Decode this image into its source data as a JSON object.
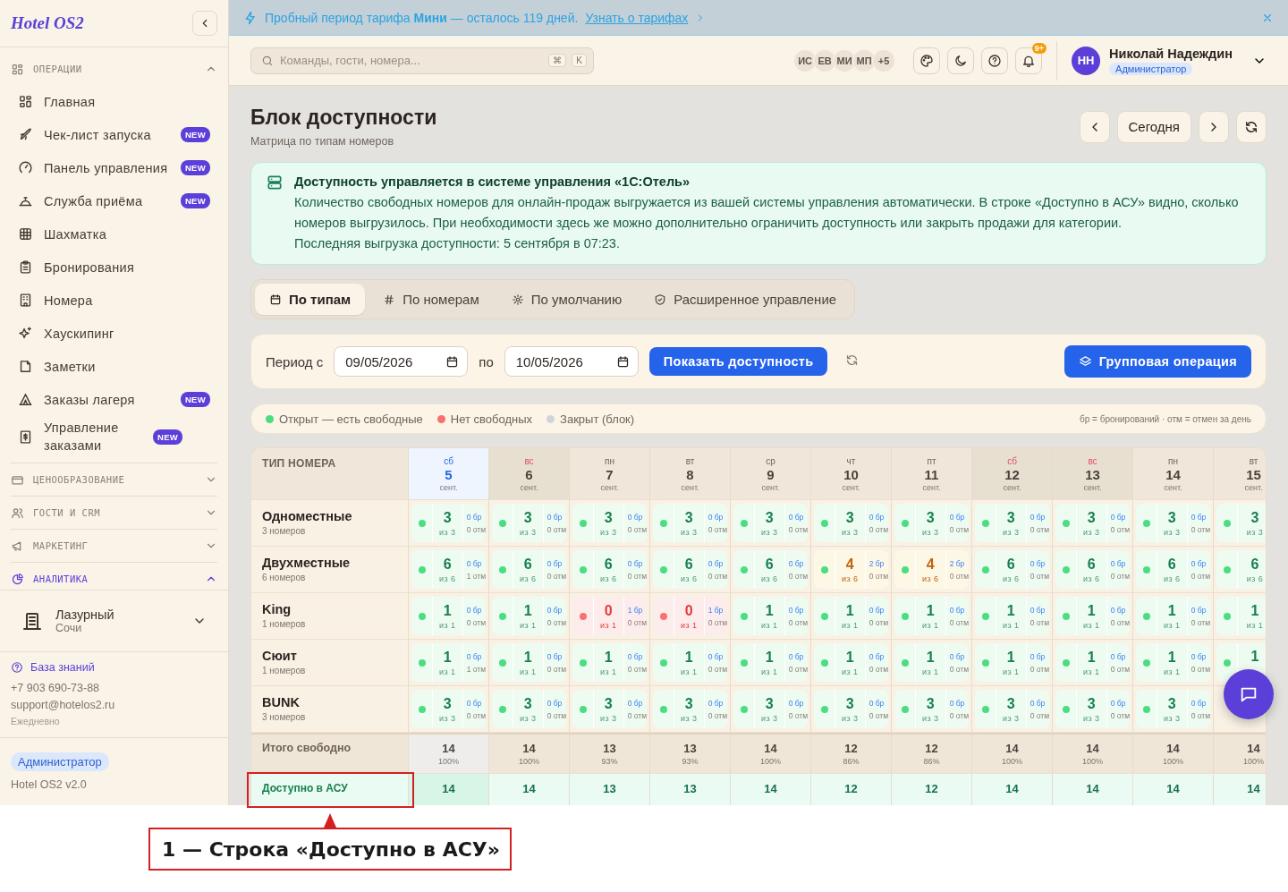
{
  "trial_banner": {
    "text": "Пробный период тарифа **Мини** — осталось 119 дней.",
    "link": "Узнать о тарифах"
  },
  "sidebar": {
    "logo": "Hotel OS2",
    "sections": [
      {
        "title": "ОПЕРАЦИИ",
        "expanded": true,
        "active": false,
        "items": [
          {
            "label": "Главная"
          },
          {
            "label": "Чек-лист запуска",
            "badge": "NEW"
          },
          {
            "label": "Панель управления",
            "badge": "NEW"
          },
          {
            "label": "Служба приёма",
            "badge": "NEW"
          },
          {
            "label": "Шахматка"
          },
          {
            "label": "Бронирования"
          },
          {
            "label": "Номера"
          },
          {
            "label": "Хаускипинг"
          },
          {
            "label": "Заметки"
          },
          {
            "label": "Заказы лагеря",
            "badge": "NEW"
          },
          {
            "label": "Управление заказами",
            "badge": "NEW"
          }
        ]
      },
      {
        "title": "ЦЕНООБРАЗОВАНИЕ",
        "expanded": false,
        "active": false
      },
      {
        "title": "ГОСТИ И CRM",
        "expanded": false,
        "active": false
      },
      {
        "title": "МАРКЕТИНГ",
        "expanded": false,
        "active": false
      },
      {
        "title": "АНАЛИТИКА",
        "expanded": true,
        "active": true
      }
    ],
    "property": {
      "name": "Лазурный",
      "city": "Сочи"
    },
    "help_link": "База знаний",
    "phone": "+7 903 690-73-88",
    "email": "support@hotelos2.ru",
    "hours": "Ежедневно",
    "role": "Администратор",
    "version": "Hotel OS2 v2.0"
  },
  "topbar": {
    "search": {
      "placeholder": "Команды, гости, номера..."
    },
    "shortcut": [
      "⌘",
      "K"
    ],
    "avatars": [
      "ИС",
      "ЕВ",
      "МИ",
      "МП"
    ],
    "avatars_more": "+5",
    "notifications": "9+",
    "user": {
      "initials": "НН",
      "name": "Николай Надеждин",
      "role": "Администратор"
    }
  },
  "page": {
    "title": "Блок доступности",
    "subtitle": "Матрица по типам номеров",
    "today": "Сегодня"
  },
  "info": {
    "title": "Доступность управляется в системе управления «1С:Отель»",
    "text": "Количество свободных номеров для онлайн-продаж выгружается из вашей системы управления автоматически. В строке «Доступно в АСУ» видно, сколько номеров выгрузилось. При необходимости здесь же можно дополнительно ограничить доступность или закрыть продажи для категории.",
    "last_sync": "Последняя выгрузка доступности: 5 сентября в 07:23."
  },
  "tabs": [
    {
      "label": "По типам",
      "selected": true
    },
    {
      "label": "По номерам",
      "selected": false
    },
    {
      "label": "По умолчанию",
      "selected": false
    },
    {
      "label": "Расширенное управление",
      "selected": false
    }
  ],
  "filter": {
    "from_label": "Период с",
    "from": "09/05/2026",
    "to_label": "по",
    "to": "10/05/2026",
    "show_button": "Показать доступность",
    "group_button": "Групповая операция"
  },
  "legend": {
    "items": [
      {
        "label": "Открыт — есть свободные",
        "color": "#4ade80"
      },
      {
        "label": "Нет свободных",
        "color": "#f87171"
      },
      {
        "label": "Закрыт (блок)",
        "color": "#d1d5db"
      }
    ],
    "note": "бр = бронирований · отм = отмен за день"
  },
  "table": {
    "corner": "ТИП НОМЕРА",
    "days": [
      {
        "weekday": "сб",
        "day": "5",
        "month": "сент.",
        "weekend": true,
        "selected": true
      },
      {
        "weekday": "вс",
        "day": "6",
        "month": "сент.",
        "weekend": true,
        "selected": false
      },
      {
        "weekday": "пн",
        "day": "7",
        "month": "сент.",
        "weekend": false,
        "selected": false
      },
      {
        "weekday": "вт",
        "day": "8",
        "month": "сент.",
        "weekend": false,
        "selected": false
      },
      {
        "weekday": "ср",
        "day": "9",
        "month": "сент.",
        "weekend": false,
        "selected": false
      },
      {
        "weekday": "чт",
        "day": "10",
        "month": "сент.",
        "weekend": false,
        "selected": false
      },
      {
        "weekday": "пт",
        "day": "11",
        "month": "сент.",
        "weekend": false,
        "selected": false
      },
      {
        "weekday": "сб",
        "day": "12",
        "month": "сент.",
        "weekend": true,
        "selected": false
      },
      {
        "weekday": "вс",
        "day": "13",
        "month": "сент.",
        "weekend": true,
        "selected": false
      },
      {
        "weekday": "пн",
        "day": "14",
        "month": "сент.",
        "weekend": false,
        "selected": false
      },
      {
        "weekday": "вт",
        "day": "15",
        "month": "сент.",
        "weekend": false,
        "selected": false
      }
    ],
    "rows": [
      {
        "name": "Одноместные",
        "count": "3 номеров",
        "cells": [
          {
            "kind": "open",
            "free": "3",
            "total": "из 3",
            "booked": "0 бр",
            "cancelled": "0 отм"
          },
          {
            "kind": "open",
            "free": "3",
            "total": "из 3",
            "booked": "0 бр",
            "cancelled": "0 отм"
          },
          {
            "kind": "open",
            "free": "3",
            "total": "из 3",
            "booked": "0 бр",
            "cancelled": "0 отм"
          },
          {
            "kind": "open",
            "free": "3",
            "total": "из 3",
            "booked": "0 бр",
            "cancelled": "0 отм"
          },
          {
            "kind": "open",
            "free": "3",
            "total": "из 3",
            "booked": "0 бр",
            "cancelled": "0 отм"
          },
          {
            "kind": "open",
            "free": "3",
            "total": "из 3",
            "booked": "0 бр",
            "cancelled": "0 отм"
          },
          {
            "kind": "open",
            "free": "3",
            "total": "из 3",
            "booked": "0 бр",
            "cancelled": "0 отм"
          },
          {
            "kind": "open",
            "free": "3",
            "total": "из 3",
            "booked": "0 бр",
            "cancelled": "0 отм"
          },
          {
            "kind": "open",
            "free": "3",
            "total": "из 3",
            "booked": "0 бр",
            "cancelled": "0 отм"
          },
          {
            "kind": "open",
            "free": "3",
            "total": "из 3",
            "booked": "0 бр",
            "cancelled": "0 отм"
          },
          {
            "kind": "open",
            "free": "3",
            "total": "из 3"
          }
        ]
      },
      {
        "name": "Двухместные",
        "count": "6 номеров",
        "cells": [
          {
            "kind": "open",
            "free": "6",
            "total": "из 6",
            "booked": "0 бр",
            "cancelled": "1 отм"
          },
          {
            "kind": "open",
            "free": "6",
            "total": "из 6",
            "booked": "0 бр",
            "cancelled": "0 отм"
          },
          {
            "kind": "open",
            "free": "6",
            "total": "из 6",
            "booked": "0 бр",
            "cancelled": "0 отм"
          },
          {
            "kind": "open",
            "free": "6",
            "total": "из 6",
            "booked": "0 бр",
            "cancelled": "0 отм"
          },
          {
            "kind": "open",
            "free": "6",
            "total": "из 6",
            "booked": "0 бр",
            "cancelled": "0 отм"
          },
          {
            "kind": "low",
            "free": "4",
            "total": "из 6",
            "booked": "2 бр",
            "cancelled": "0 отм"
          },
          {
            "kind": "low",
            "free": "4",
            "total": "из 6",
            "booked": "2 бр",
            "cancelled": "0 отм"
          },
          {
            "kind": "open",
            "free": "6",
            "total": "из 6",
            "booked": "0 бр",
            "cancelled": "0 отм"
          },
          {
            "kind": "open",
            "free": "6",
            "total": "из 6",
            "booked": "0 бр",
            "cancelled": "0 отм"
          },
          {
            "kind": "open",
            "free": "6",
            "total": "из 6",
            "booked": "0 бр",
            "cancelled": "0 отм"
          },
          {
            "kind": "open",
            "free": "6",
            "total": "из 6"
          }
        ]
      },
      {
        "name": "King",
        "count": "1 номеров",
        "cells": [
          {
            "kind": "open",
            "free": "1",
            "total": "из 1",
            "booked": "0 бр",
            "cancelled": "0 отм"
          },
          {
            "kind": "open",
            "free": "1",
            "total": "из 1",
            "booked": "0 бр",
            "cancelled": "0 отм"
          },
          {
            "kind": "full",
            "free": "0",
            "total": "из 1",
            "booked": "1 бр",
            "cancelled": "0 отм"
          },
          {
            "kind": "full",
            "free": "0",
            "total": "из 1",
            "booked": "1 бр",
            "cancelled": "0 отм"
          },
          {
            "kind": "open",
            "free": "1",
            "total": "из 1",
            "booked": "0 бр",
            "cancelled": "0 отм"
          },
          {
            "kind": "open",
            "free": "1",
            "total": "из 1",
            "booked": "0 бр",
            "cancelled": "0 отм"
          },
          {
            "kind": "open",
            "free": "1",
            "total": "из 1",
            "booked": "0 бр",
            "cancelled": "0 отм"
          },
          {
            "kind": "open",
            "free": "1",
            "total": "из 1",
            "booked": "0 бр",
            "cancelled": "0 отм"
          },
          {
            "kind": "open",
            "free": "1",
            "total": "из 1",
            "booked": "0 бр",
            "cancelled": "0 отм"
          },
          {
            "kind": "open",
            "free": "1",
            "total": "из 1",
            "booked": "0 бр",
            "cancelled": "0 отм"
          },
          {
            "kind": "open",
            "free": "1",
            "total": "из 1"
          }
        ]
      },
      {
        "name": "Сюит",
        "count": "1 номеров",
        "cells": [
          {
            "kind": "open",
            "free": "1",
            "total": "из 1",
            "booked": "0 бр",
            "cancelled": "1 отм"
          },
          {
            "kind": "open",
            "free": "1",
            "total": "из 1",
            "booked": "0 бр",
            "cancelled": "0 отм"
          },
          {
            "kind": "open",
            "free": "1",
            "total": "из 1",
            "booked": "0 бр",
            "cancelled": "0 отм"
          },
          {
            "kind": "open",
            "free": "1",
            "total": "из 1",
            "booked": "0 бр",
            "cancelled": "0 отм"
          },
          {
            "kind": "open",
            "free": "1",
            "total": "из 1",
            "booked": "0 бр",
            "cancelled": "0 отм"
          },
          {
            "kind": "open",
            "free": "1",
            "total": "из 1",
            "booked": "0 бр",
            "cancelled": "0 отм"
          },
          {
            "kind": "open",
            "free": "1",
            "total": "из 1",
            "booked": "0 бр",
            "cancelled": "0 отм"
          },
          {
            "kind": "open",
            "free": "1",
            "total": "из 1",
            "booked": "0 бр",
            "cancelled": "0 отм"
          },
          {
            "kind": "open",
            "free": "1",
            "total": "из 1",
            "booked": "0 бр",
            "cancelled": "0 отм"
          },
          {
            "kind": "open",
            "free": "1",
            "total": "из 1",
            "booked": "0 бр",
            "cancelled": "0 отм"
          },
          {
            "kind": "open",
            "free": "1"
          }
        ]
      },
      {
        "name": "BUNK",
        "count": "3 номеров",
        "cells": [
          {
            "kind": "open",
            "free": "3",
            "total": "из 3",
            "booked": "0 бр",
            "cancelled": "0 отм"
          },
          {
            "kind": "open",
            "free": "3",
            "total": "из 3",
            "booked": "0 бр",
            "cancelled": "0 отм"
          },
          {
            "kind": "open",
            "free": "3",
            "total": "из 3",
            "booked": "0 бр",
            "cancelled": "0 отм"
          },
          {
            "kind": "open",
            "free": "3",
            "total": "из 3",
            "booked": "0 бр",
            "cancelled": "0 отм"
          },
          {
            "kind": "open",
            "free": "3",
            "total": "из 3",
            "booked": "0 бр",
            "cancelled": "0 отм"
          },
          {
            "kind": "open",
            "free": "3",
            "total": "из 3",
            "booked": "0 бр",
            "cancelled": "0 отм"
          },
          {
            "kind": "open",
            "free": "3",
            "total": "из 3",
            "booked": "0 бр",
            "cancelled": "0 отм"
          },
          {
            "kind": "open",
            "free": "3",
            "total": "из 3",
            "booked": "0 бр",
            "cancelled": "0 отм"
          },
          {
            "kind": "open",
            "free": "3",
            "total": "из 3",
            "booked": "0 бр",
            "cancelled": "0 отм"
          },
          {
            "kind": "open",
            "free": "3",
            "total": "из 3",
            "booked": "0 бр",
            "cancelled": "0 отм"
          }
        ]
      }
    ],
    "total": {
      "label": "Итого свободно",
      "cells": [
        {
          "value": "14",
          "percent": "100%"
        },
        {
          "value": "14",
          "percent": "100%"
        },
        {
          "value": "13",
          "percent": "93%"
        },
        {
          "value": "13",
          "percent": "93%"
        },
        {
          "value": "14",
          "percent": "100%"
        },
        {
          "value": "12",
          "percent": "86%"
        },
        {
          "value": "12",
          "percent": "86%"
        },
        {
          "value": "14",
          "percent": "100%"
        },
        {
          "value": "14",
          "percent": "100%"
        },
        {
          "value": "14",
          "percent": "100%"
        },
        {
          "value": "14",
          "percent": "100%"
        }
      ]
    },
    "asu": {
      "label": "Доступно в АСУ",
      "values": [
        "14",
        "14",
        "13",
        "13",
        "14",
        "12",
        "12",
        "14",
        "14",
        "14",
        "14"
      ]
    }
  },
  "callout": {
    "text": "1 — Строка «Доступно в АСУ»"
  }
}
